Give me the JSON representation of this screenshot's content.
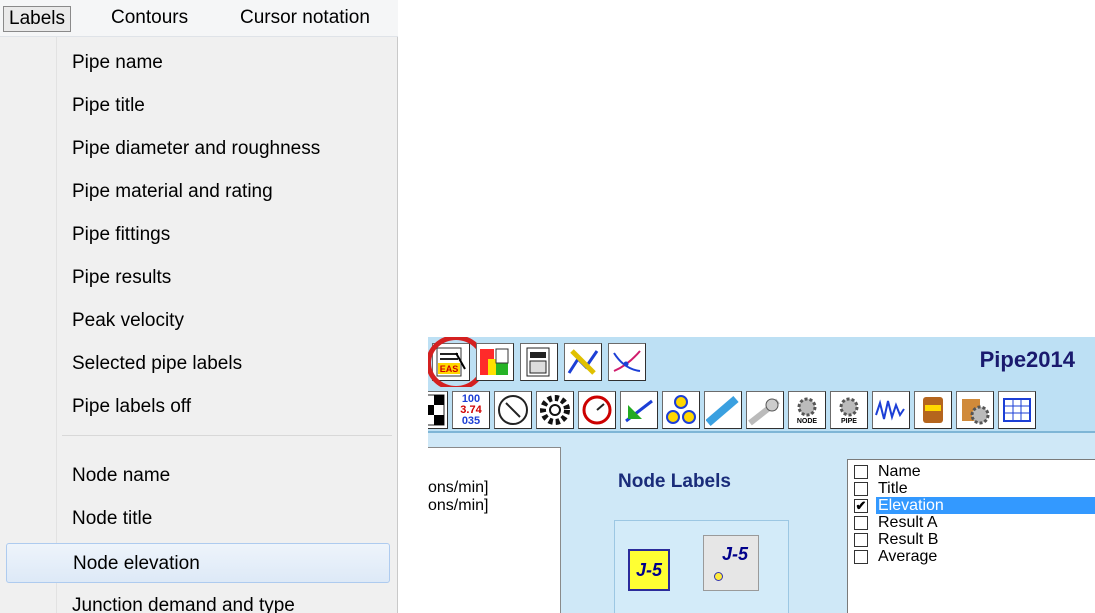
{
  "menubar": {
    "items": [
      {
        "label": "Labels"
      },
      {
        "label": "Contours"
      },
      {
        "label": "Cursor notation"
      }
    ]
  },
  "labels_menu": {
    "pipe_items": [
      "Pipe name",
      "Pipe title",
      "Pipe diameter and roughness",
      "Pipe material and rating",
      "Pipe fittings",
      "Pipe results",
      "Peak velocity",
      "Selected pipe labels",
      "Pipe labels off"
    ],
    "node_items": [
      "Node name",
      "Node title",
      "Node elevation",
      "Junction demand and type"
    ],
    "highlighted": "Node elevation"
  },
  "app": {
    "title": "Pipe2014",
    "left_panel_lines": [
      "ons/min]",
      "ons/min]"
    ],
    "node_labels": {
      "heading": "Node Labels",
      "button_a_label": "J-5",
      "button_b_label": "J-5"
    },
    "label_options": [
      {
        "label": "Name",
        "checked": false
      },
      {
        "label": "Title",
        "checked": false
      },
      {
        "label": "Elevation",
        "checked": true
      },
      {
        "label": "Result A",
        "checked": false
      },
      {
        "label": "Result B",
        "checked": false
      },
      {
        "label": "Average",
        "checked": false
      }
    ],
    "toolbar_row2_numbers": {
      "top": "100",
      "mid": "3.74",
      "bot": "035"
    },
    "toolbar_row2_small_labels": [
      "NODE",
      "PIPE"
    ]
  },
  "colors": {
    "highlight_circle": "#d42020",
    "app_background": "#cfe8f7",
    "selection": "#3399ff"
  }
}
